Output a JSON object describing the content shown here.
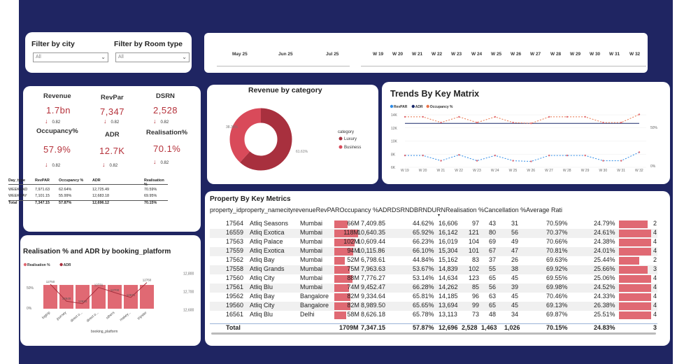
{
  "filters": {
    "city_label": "Filter by city",
    "city_value": "All",
    "room_label": "Filter by Room type",
    "room_value": "All"
  },
  "dates": [
    "May 25",
    "Jun 25",
    "Jul 25",
    "W 19",
    "W 20",
    "W 21",
    "W 22",
    "W 23",
    "W 24",
    "W 25",
    "W 26",
    "W 27",
    "W 28",
    "W 29",
    "W 30",
    "W 31",
    "W 32"
  ],
  "kpis": {
    "revenue": {
      "label": "Revenue",
      "value": "1.7bn",
      "delta": "0.82"
    },
    "revpar": {
      "label": "RevPar",
      "value": "7,347",
      "delta": "0.82"
    },
    "dsrn": {
      "label": "DSRN",
      "value": "2,528",
      "delta": "0.82"
    },
    "occupancy": {
      "label": "Occupancy%",
      "value": "57.9%",
      "delta": "0.82"
    },
    "adr": {
      "label": "ADR",
      "value": "12.7K",
      "delta": "0.82"
    },
    "realisation": {
      "label": "Realisation%",
      "value": "70.1%",
      "delta": "0.82"
    }
  },
  "daytype_table": {
    "headers": [
      "Day_type",
      "RevPAR",
      "Occupancy %",
      "ADR",
      "Realisation %"
    ],
    "rows": [
      [
        "WEEKEND",
        "7,971.63",
        "62.64%",
        "12,725.49",
        "70.59%"
      ],
      [
        "WEEKDAY",
        "7,101.15",
        "55.99%",
        "12,683.18",
        "69.95%"
      ],
      [
        "Total",
        "7,347.15",
        "57.87%",
        "12,696.12",
        "70.15%"
      ]
    ]
  },
  "category": {
    "title": "Revenue by category",
    "legend_title": "category",
    "left_label": "38.39%",
    "right_label": "61.61%",
    "series": [
      {
        "name": "Luxury",
        "pct": 61.61,
        "color": "#a8303e"
      },
      {
        "name": "Business",
        "pct": 38.39,
        "color": "#d94a5a"
      }
    ]
  },
  "trends": {
    "title": "Trends By Key Matrix",
    "legend": [
      {
        "name": "RevPAR",
        "color": "#2d8be6"
      },
      {
        "name": "ADR",
        "color": "#1a2a6c"
      },
      {
        "name": "Occupancy %",
        "color": "#e8734a"
      }
    ],
    "yleft": [
      "14K",
      "12K",
      "10K",
      "8K",
      "6K"
    ],
    "yright": [
      "50%",
      "0%"
    ],
    "x": [
      "W 19",
      "W 20",
      "W 21",
      "W 22",
      "W 23",
      "W 24",
      "W 25",
      "W 26",
      "W 27",
      "W 28",
      "W 29",
      "W 30",
      "W 31",
      "W 32"
    ]
  },
  "realisation_chart": {
    "title": "Realisation % and ADR by booking_platform",
    "legend": [
      {
        "name": "Realisation %",
        "color": "#e06973"
      },
      {
        "name": "ADR",
        "color": "#a8303e"
      }
    ],
    "xlabel": "booking_platform",
    "yleft": [
      "50%",
      "0%"
    ],
    "yright": [
      "12,800",
      "12,700",
      "12,600"
    ]
  },
  "chart_data": [
    {
      "type": "bar",
      "title": "Realisation % and ADR by booking_platform",
      "xlabel": "booking_platform",
      "categories": [
        "logtrip",
        "journey",
        "direct o...",
        "direct o...",
        "others",
        "makey...",
        "tripster"
      ],
      "series": [
        {
          "name": "Realisation %",
          "values": [
            70,
            70,
            70,
            70,
            70,
            70,
            70
          ]
        },
        {
          "name": "ADR",
          "values": [
            12750,
            12649,
            12634,
            12731,
            12700,
            12671,
            12760
          ],
          "labels": [
            "12750",
            "12649",
            "12634",
            "12731",
            "12700",
            "12671",
            "12760"
          ]
        }
      ],
      "ylim_left": [
        0,
        100
      ],
      "ylim_right": [
        12600,
        12800
      ]
    },
    {
      "type": "line",
      "title": "Trends By Key Matrix",
      "x": [
        "W 19",
        "W 20",
        "W 21",
        "W 22",
        "W 23",
        "W 24",
        "W 25",
        "W 26",
        "W 27",
        "W 28",
        "W 29",
        "W 30",
        "W 31",
        "W 32"
      ],
      "series": [
        {
          "name": "RevPAR",
          "values": [
            7800,
            7800,
            7000,
            7900,
            7000,
            7800,
            7000,
            6900,
            7800,
            7800,
            7800,
            7000,
            7000,
            8300
          ]
        },
        {
          "name": "ADR",
          "values": [
            12700,
            12700,
            12700,
            12700,
            12700,
            12700,
            12700,
            12700,
            12700,
            12700,
            12700,
            12700,
            12700,
            12700
          ]
        },
        {
          "name": "Occupancy %",
          "values": [
            62,
            62,
            55,
            62,
            55,
            62,
            55,
            54,
            62,
            62,
            62,
            55,
            55,
            65
          ]
        }
      ]
    }
  ],
  "property": {
    "title": "Property By Key Metrics",
    "headers": [
      "property_id",
      "property_name",
      "city",
      "revenue",
      "RevPAR",
      "Occupancy %",
      "ADR",
      "DSRN",
      "DBRN",
      "DURN",
      "Realisation %",
      "Cancellation %",
      "Average Rati"
    ],
    "rows": [
      {
        "id": "17564",
        "name": "Atliq Seasons",
        "city": "Mumbai",
        "rev": "66M",
        "revpar": "7,409.85",
        "occ": "44.62%",
        "adr": "16,606",
        "dsrn": "97",
        "dbrn": "43",
        "durn": "31",
        "real": "70.59%",
        "canc": "24.79%",
        "avg": "2",
        "revfrac": 0.56,
        "avgfrac": 0.85
      },
      {
        "id": "16559",
        "name": "Atliq Exotica",
        "city": "Mumbai",
        "rev": "118M",
        "revpar": "10,640.35",
        "occ": "65.92%",
        "adr": "16,142",
        "dsrn": "121",
        "dbrn": "80",
        "durn": "56",
        "real": "70.37%",
        "canc": "24.61%",
        "avg": "4",
        "revfrac": 1.0,
        "avgfrac": 0.95
      },
      {
        "id": "17563",
        "name": "Atliq Palace",
        "city": "Mumbai",
        "rev": "102M",
        "revpar": "10,609.44",
        "occ": "66.23%",
        "adr": "16,019",
        "dsrn": "104",
        "dbrn": "69",
        "durn": "49",
        "real": "70.66%",
        "canc": "24.38%",
        "avg": "4",
        "revfrac": 0.86,
        "avgfrac": 0.95
      },
      {
        "id": "17559",
        "name": "Atliq Exotica",
        "city": "Mumbai",
        "rev": "94M",
        "revpar": "10,115.86",
        "occ": "66.10%",
        "adr": "15,304",
        "dsrn": "101",
        "dbrn": "67",
        "durn": "47",
        "real": "70.81%",
        "canc": "24.01%",
        "avg": "4",
        "revfrac": 0.8,
        "avgfrac": 0.95
      },
      {
        "id": "17562",
        "name": "Atliq Bay",
        "city": "Mumbai",
        "rev": "52M",
        "revpar": "6,798.61",
        "occ": "44.84%",
        "adr": "15,162",
        "dsrn": "83",
        "dbrn": "37",
        "durn": "26",
        "real": "69.63%",
        "canc": "25.44%",
        "avg": "2",
        "revfrac": 0.44,
        "avgfrac": 0.6
      },
      {
        "id": "17558",
        "name": "Atliq Grands",
        "city": "Mumbai",
        "rev": "75M",
        "revpar": "7,963.63",
        "occ": "53.67%",
        "adr": "14,839",
        "dsrn": "102",
        "dbrn": "55",
        "durn": "38",
        "real": "69.92%",
        "canc": "25.66%",
        "avg": "3",
        "revfrac": 0.64,
        "avgfrac": 0.85
      },
      {
        "id": "17560",
        "name": "Atliq City",
        "city": "Mumbai",
        "rev": "88M",
        "revpar": "7,776.27",
        "occ": "53.14%",
        "adr": "14,634",
        "dsrn": "123",
        "dbrn": "65",
        "durn": "45",
        "real": "69.55%",
        "canc": "25.06%",
        "avg": "4",
        "revfrac": 0.75,
        "avgfrac": 0.95
      },
      {
        "id": "17561",
        "name": "Atliq Blu",
        "city": "Mumbai",
        "rev": "74M",
        "revpar": "9,452.47",
        "occ": "66.28%",
        "adr": "14,262",
        "dsrn": "85",
        "dbrn": "56",
        "durn": "39",
        "real": "69.98%",
        "canc": "24.52%",
        "avg": "4",
        "revfrac": 0.63,
        "avgfrac": 0.95
      },
      {
        "id": "19562",
        "name": "Atliq Bay",
        "city": "Bangalore",
        "rev": "82M",
        "revpar": "9,334.64",
        "occ": "65.81%",
        "adr": "14,185",
        "dsrn": "96",
        "dbrn": "63",
        "durn": "45",
        "real": "70.46%",
        "canc": "24.33%",
        "avg": "4",
        "revfrac": 0.69,
        "avgfrac": 0.95
      },
      {
        "id": "19560",
        "name": "Atliq City",
        "city": "Bangalore",
        "rev": "82M",
        "revpar": "8,989.50",
        "occ": "65.65%",
        "adr": "13,694",
        "dsrn": "99",
        "dbrn": "65",
        "durn": "45",
        "real": "69.13%",
        "canc": "26.38%",
        "avg": "4",
        "revfrac": 0.69,
        "avgfrac": 0.95
      },
      {
        "id": "16561",
        "name": "Atliq Blu",
        "city": "Delhi",
        "rev": "58M",
        "revpar": "8,626.18",
        "occ": "65.78%",
        "adr": "13,113",
        "dsrn": "73",
        "dbrn": "48",
        "durn": "34",
        "real": "69.87%",
        "canc": "25.51%",
        "avg": "4",
        "revfrac": 0.49,
        "avgfrac": 0.95
      }
    ],
    "total": {
      "label": "Total",
      "rev": "1709M",
      "revpar": "7,347.15",
      "occ": "57.87%",
      "adr": "12,696",
      "dsrn": "2,528",
      "dbrn": "1,463",
      "durn": "1,026",
      "real": "70.15%",
      "canc": "24.83%",
      "avg": "3"
    }
  }
}
